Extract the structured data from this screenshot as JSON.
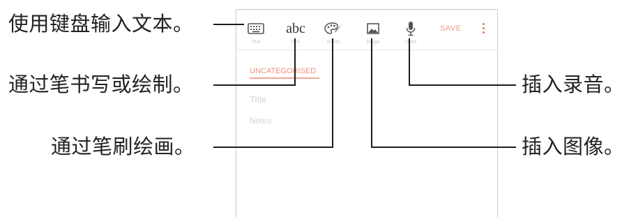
{
  "callouts": {
    "keyboard": "使用键盘输入文本。",
    "handwriting": "通过笔书写或绘制。",
    "brush": "通过笔刷绘画。",
    "voice": "插入录音。",
    "image": "插入图像。"
  },
  "toolbar": {
    "keyboard_label": "Text",
    "handwriting_glyph": "abc",
    "handwriting_label": "Pen",
    "brush_label": "Brush",
    "image_label": "Image",
    "voice_label": "Voice",
    "save_label": "SAVE"
  },
  "note": {
    "category": "UNCATEGORISED",
    "title_placeholder": "Title",
    "notes_placeholder": "Notes"
  },
  "colors": {
    "accent": "#e8705c",
    "callout_line": "#1c1c1c"
  }
}
